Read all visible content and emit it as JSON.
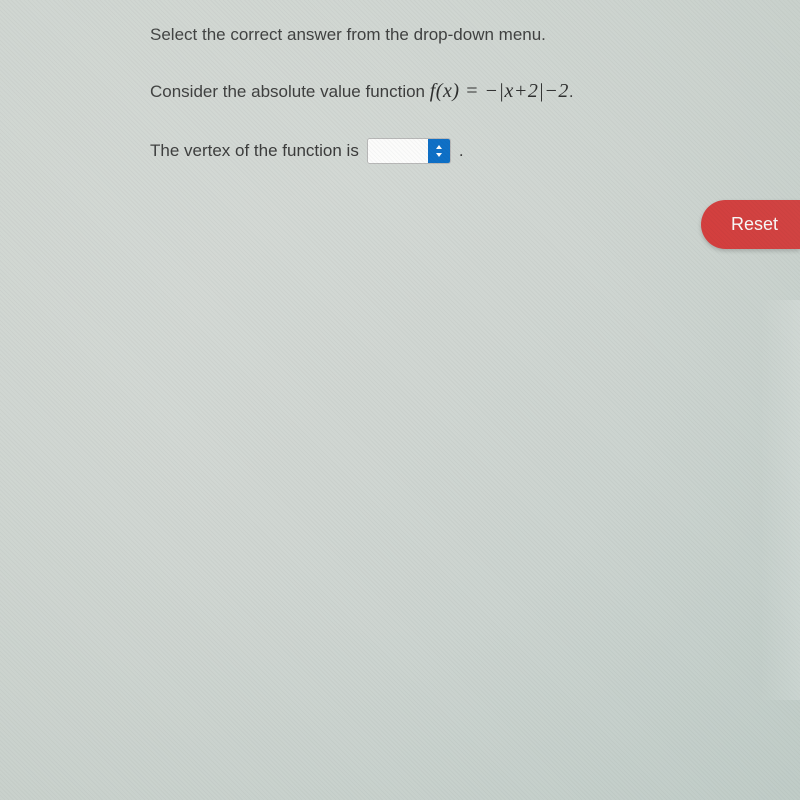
{
  "instruction": "Select the correct answer from the drop-down menu.",
  "question": {
    "prefix": "Consider the absolute value function ",
    "formula": "f(x) = −|x+2|−2",
    "suffix": "."
  },
  "answer": {
    "prefix": "The vertex of the function is",
    "dropdown_value": "",
    "period": "."
  },
  "buttons": {
    "reset": "Reset"
  }
}
